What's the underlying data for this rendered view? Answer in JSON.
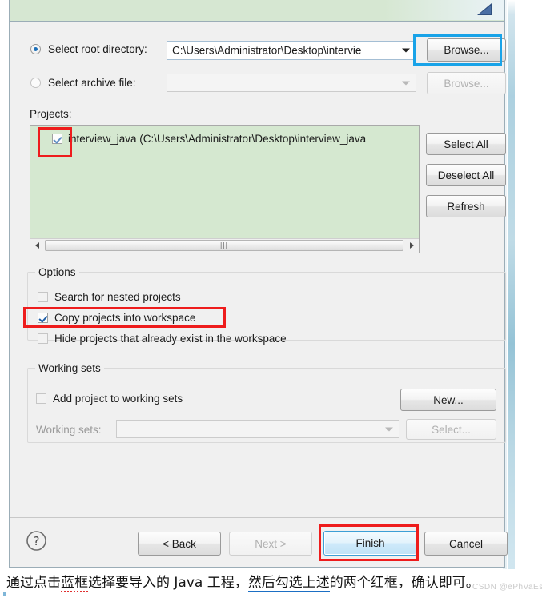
{
  "window": {
    "banner_icon": "import-wizard-icon"
  },
  "source": {
    "root_directory": {
      "label": "Select root directory:",
      "selected": true,
      "value": "C:\\Users\\Administrator\\Desktop\\intervie",
      "browse_label": "Browse..."
    },
    "archive_file": {
      "label": "Select archive file:",
      "selected": false,
      "value": "",
      "browse_label": "Browse..."
    }
  },
  "projects": {
    "label": "Projects:",
    "items": [
      {
        "checked": true,
        "text": "interview_java (C:\\Users\\Administrator\\Desktop\\interview_java"
      }
    ],
    "buttons": {
      "select_all": "Select All",
      "deselect_all": "Deselect All",
      "refresh": "Refresh"
    },
    "scrollbar": {
      "left_arrow": "left-arrow-icon",
      "right_arrow": "right-arrow-icon",
      "grip": "|||"
    }
  },
  "options": {
    "title": "Options",
    "items": [
      {
        "label": "Search for nested projects",
        "checked": false
      },
      {
        "label": "Copy projects into workspace",
        "checked": true
      },
      {
        "label": "Hide projects that already exist in the workspace",
        "checked": false
      }
    ]
  },
  "working_sets": {
    "title": "Working sets",
    "add_checkbox": {
      "label": "Add project to working sets",
      "checked": false
    },
    "new_button": "New...",
    "sets_label": "Working sets:",
    "sets_value": "",
    "select_button": "Select..."
  },
  "footer": {
    "help_icon": "help-question-icon",
    "back": "< Back",
    "next": "Next >",
    "finish": "Finish",
    "cancel": "Cancel"
  },
  "annotations": {
    "highlight_red": "#ee1c1c",
    "highlight_blue": "#19a3e8",
    "caption_part1": "通过点击",
    "caption_blue": "蓝框",
    "caption_part2": "选择要导入的 Java 工程，",
    "caption_underline": "然后勾选上述",
    "caption_part3": "的两个红框，确认即可。",
    "watermark": "CSDN @ePhVaEsr"
  }
}
